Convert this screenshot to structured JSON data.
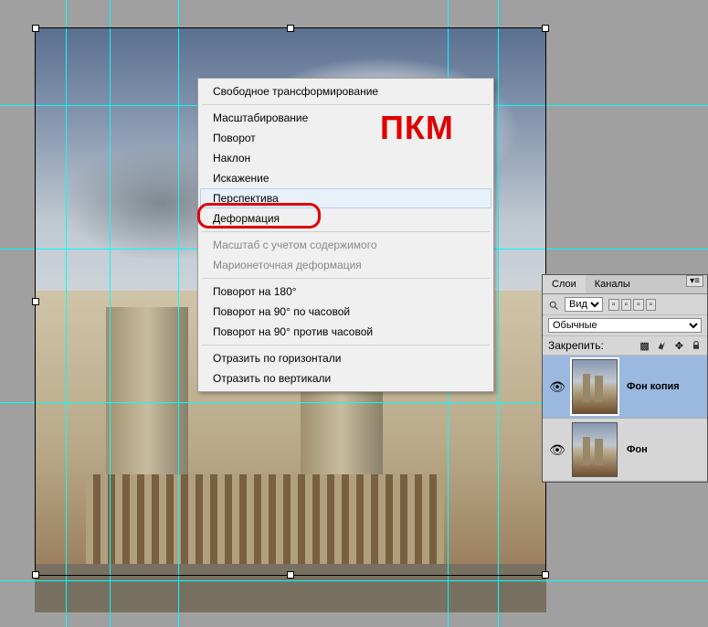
{
  "annotation": "ПКМ",
  "context_menu": {
    "items": [
      {
        "label": "Свободное трансформирование",
        "disabled": false,
        "sep_after": true
      },
      {
        "label": "Масштабирование",
        "disabled": false
      },
      {
        "label": "Поворот",
        "disabled": false
      },
      {
        "label": "Наклон",
        "disabled": false
      },
      {
        "label": "Искажение",
        "disabled": false
      },
      {
        "label": "Перспектива",
        "disabled": false,
        "highlighted": true
      },
      {
        "label": "Деформация",
        "disabled": false,
        "sep_after": true
      },
      {
        "label": "Масштаб с учетом содержимого",
        "disabled": true
      },
      {
        "label": "Марионеточная деформация",
        "disabled": true,
        "sep_after": true
      },
      {
        "label": "Поворот на 180°",
        "disabled": false
      },
      {
        "label": "Поворот на 90° по часовой",
        "disabled": false
      },
      {
        "label": "Поворот на 90° против часовой",
        "disabled": false,
        "sep_after": true
      },
      {
        "label": "Отразить по горизонтали",
        "disabled": false
      },
      {
        "label": "Отразить по вертикали",
        "disabled": false
      }
    ]
  },
  "layers_panel": {
    "tabs": [
      {
        "label": "Слои",
        "active": true
      },
      {
        "label": "Каналы",
        "active": false
      }
    ],
    "filter_label": "Вид",
    "blend_mode": "Обычные",
    "lock_label": "Закрепить:",
    "layers": [
      {
        "name": "Фон копия",
        "visible": true,
        "selected": true
      },
      {
        "name": "Фон",
        "visible": true,
        "selected": false
      }
    ]
  }
}
